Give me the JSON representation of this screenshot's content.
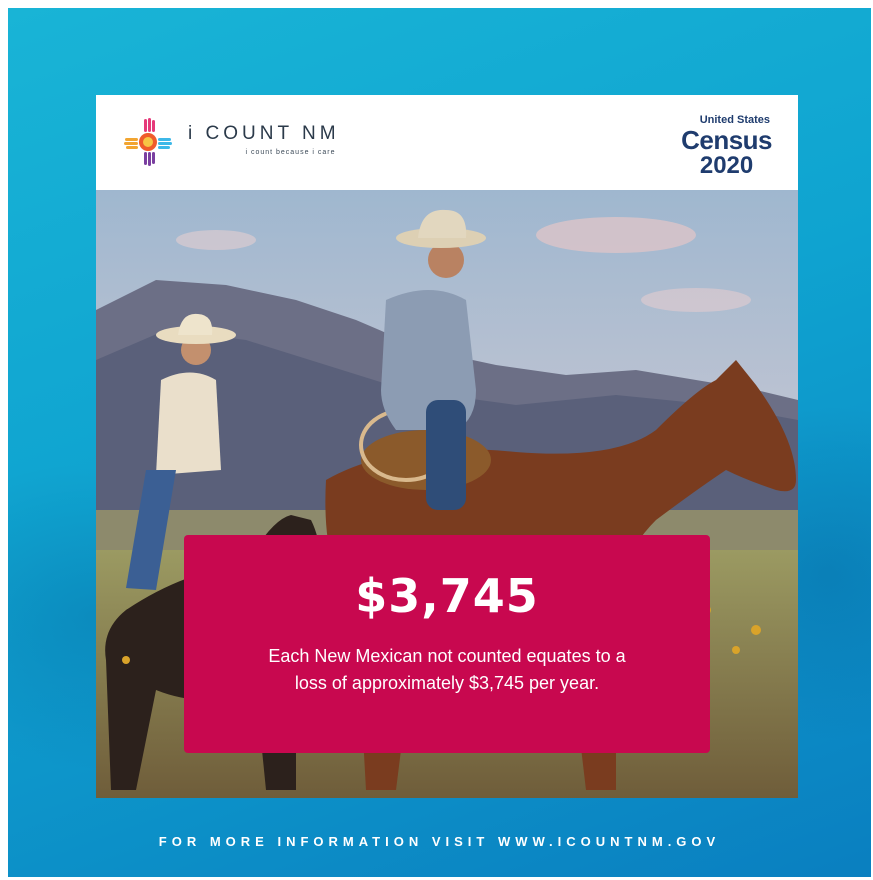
{
  "header": {
    "logo_icon": "zia-hands-icon",
    "brand_name": "i COUNT NM",
    "tagline": "i count because i care",
    "census_top": "United States",
    "census_word": "Census",
    "census_year": "2020"
  },
  "banner": {
    "amount": "$3,745",
    "text_line1": "Each New Mexican not counted equates to a",
    "text_line2": "loss of approximately $3,745 per year."
  },
  "footer": {
    "text": "FOR MORE INFORMATION VISIT WWW.ICOUNTNM.GOV"
  },
  "colors": {
    "background": "#12a8d3",
    "banner": "#c8084f",
    "census": "#1f3c6e"
  }
}
